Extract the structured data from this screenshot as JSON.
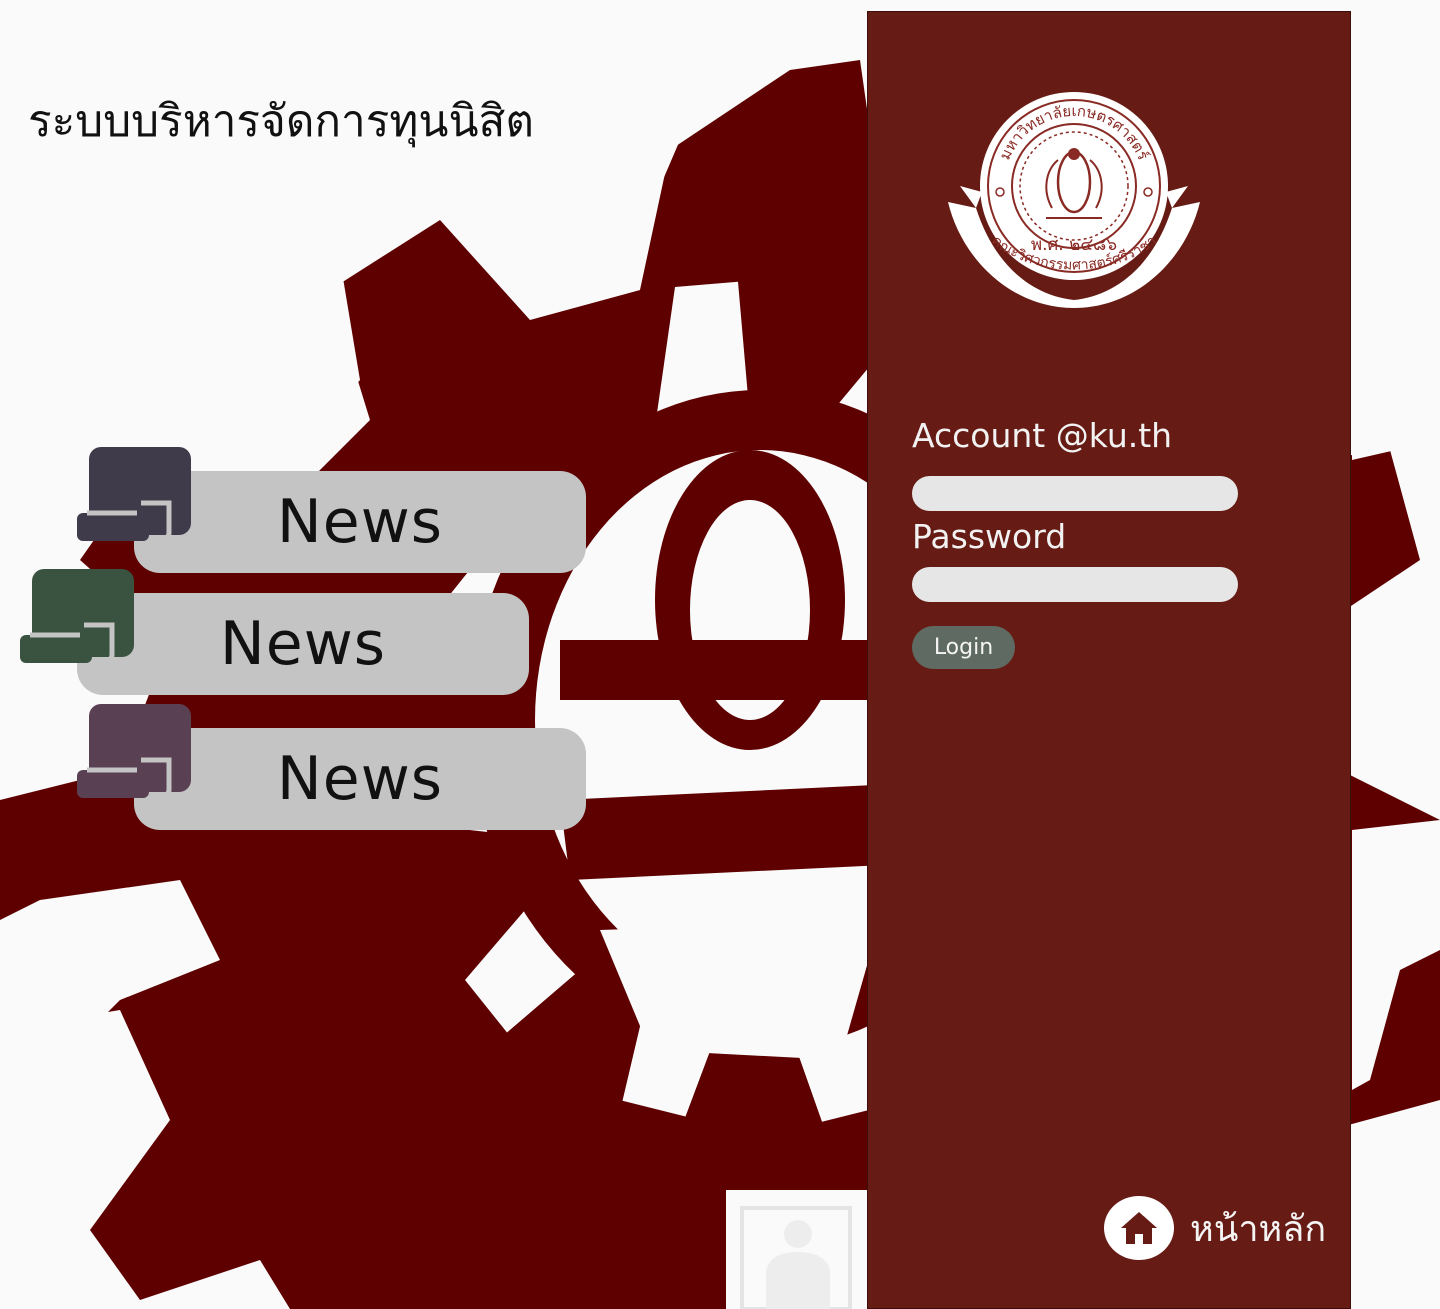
{
  "app": {
    "title": "ระบบบริหารจัดการทุนนิสิต"
  },
  "news": {
    "items": [
      {
        "label": "News",
        "icon": "scroll-icon",
        "icon_color": "#3f3b4a"
      },
      {
        "label": "News",
        "icon": "scroll-icon",
        "icon_color": "#3a5240"
      },
      {
        "label": "News",
        "icon": "scroll-icon",
        "icon_color": "#5a4053"
      }
    ]
  },
  "login": {
    "account_label": "Account @ku.th",
    "account_value": "",
    "password_label": "Password",
    "password_value": "",
    "button_label": "Login"
  },
  "logo": {
    "top_text": "มหาวิทยาลัยเกษตรศาสตร์",
    "year_text": "พ.ศ. ๒๔๘๖",
    "ribbon_text": "คณะวิศวกรรมศาสตร์ศรีราชา"
  },
  "nav": {
    "home_label": "หน้าหลัก",
    "home_icon": "home-icon"
  },
  "colors": {
    "panel": "#661c14",
    "gear": "#5e0000",
    "pill": "#c4c4c4",
    "input": "#e6e6e6",
    "button": "#5f6b62"
  }
}
